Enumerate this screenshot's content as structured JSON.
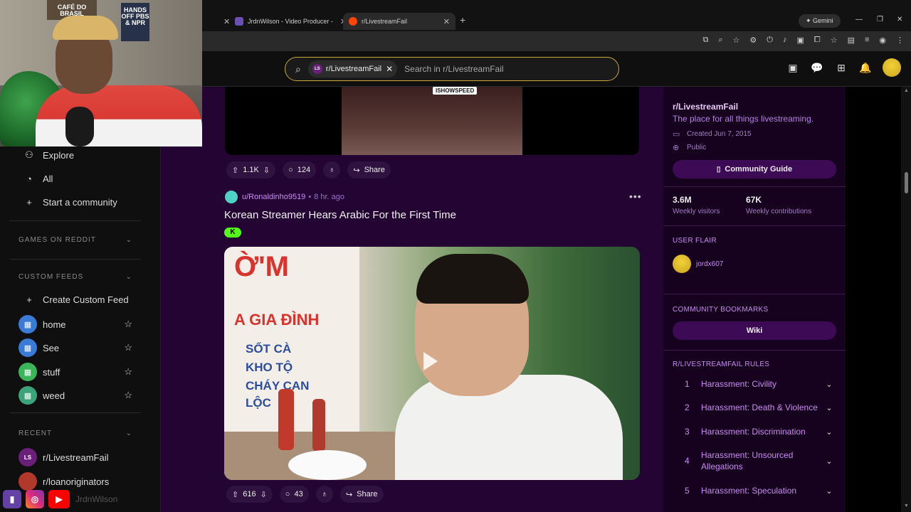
{
  "webcam": {
    "poster1": "CAFÉ DO BRASIL",
    "poster2": "HANDS OFF PBS & NPR"
  },
  "social": {
    "handle": "JrdnWilson"
  },
  "browser": {
    "tabs": [
      {
        "label": "JrdnWilson - Video Producer -",
        "active": false
      },
      {
        "label": "r/LivestreamFail",
        "active": true
      }
    ],
    "gemini_label": "Gemini"
  },
  "header": {
    "chip_label": "r/LivestreamFail",
    "chip_icon_text": "LS",
    "search_placeholder": "Search in r/LivestreamFail"
  },
  "sidebar": {
    "nav": [
      {
        "label": "Explore",
        "icon": "explore-icon"
      },
      {
        "label": "All",
        "icon": "all-icon"
      },
      {
        "label": "Start a community",
        "icon": "plus-icon"
      }
    ],
    "games_section": "GAMES ON REDDIT",
    "custom_feeds_section": "CUSTOM FEEDS",
    "create_feed": "Create Custom Feed",
    "feeds": [
      {
        "label": "home",
        "color": "#3a7bd5"
      },
      {
        "label": "See",
        "color": "#3a7bd5"
      },
      {
        "label": "stuff",
        "color": "#3bb55a"
      },
      {
        "label": "weed",
        "color": "#3ba37a"
      }
    ],
    "recent_section": "RECENT",
    "recent": [
      {
        "label": "r/LivestreamFail",
        "icon_text": "LS"
      },
      {
        "label": "r/loanoriginators",
        "icon_text": ""
      }
    ]
  },
  "post_top": {
    "badge": "ISHOWSPEED",
    "upvotes": "1.1K",
    "comments": "124",
    "share": "Share"
  },
  "post": {
    "username": "u/Ronaldinho9519",
    "age": "8 hr. ago",
    "title": "Korean Streamer Hears Arabic For the First Time",
    "flair": "K",
    "video_sign": [
      "Ờ'M",
      "A GIA ĐÌNH"
    ],
    "video_blue": [
      "SỐT CÀ",
      "KHO TỘ",
      "CHÁY CAN",
      "LỘC"
    ],
    "upvotes": "616",
    "comments": "43",
    "share": "Share"
  },
  "community": {
    "name": "r/LivestreamFail",
    "description": "The place for all things livestreaming.",
    "created": "Created Jun 7, 2015",
    "visibility": "Public",
    "guide_button": "Community Guide",
    "visitors_value": "3.6M",
    "visitors_label": "Weekly visitors",
    "contrib_value": "67K",
    "contrib_label": "Weekly contributions",
    "user_flair_section": "USER FLAIR",
    "user_flair_name": "jordx607",
    "bookmarks_section": "COMMUNITY BOOKMARKS",
    "wiki_button": "Wiki",
    "rules_section": "R/LIVESTREAMFAIL RULES",
    "rules": [
      {
        "num": "1",
        "text": "Harassment: Civility"
      },
      {
        "num": "2",
        "text": "Harassment: Death & Violence"
      },
      {
        "num": "3",
        "text": "Harassment: Discrimination"
      },
      {
        "num": "4",
        "text": "Harassment: Unsourced Allegations"
      },
      {
        "num": "5",
        "text": "Harassment: Speculation"
      }
    ]
  }
}
